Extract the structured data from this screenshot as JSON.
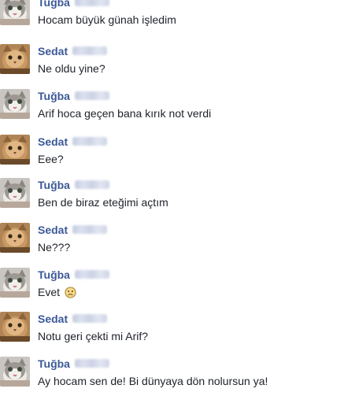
{
  "messages": [
    {
      "sender": "Tuğba",
      "avatar": "kitten-avatar-icon",
      "text": "Hocam büyük günah işledim"
    },
    {
      "sender": "Sedat",
      "avatar": "cat-avatar-icon",
      "text": "Ne oldu yine?"
    },
    {
      "sender": "Tuğba",
      "avatar": "kitten-avatar-icon",
      "text": "Arif hoca geçen bana kırık not verdi"
    },
    {
      "sender": "Sedat",
      "avatar": "cat-avatar-icon",
      "text": "Eee?"
    },
    {
      "sender": "Tuğba",
      "avatar": "kitten-avatar-icon",
      "text": "Ben de biraz eteğimi açtım"
    },
    {
      "sender": "Sedat",
      "avatar": "cat-avatar-icon",
      "text": "Ne???"
    },
    {
      "sender": "Tuğba",
      "avatar": "kitten-avatar-icon",
      "text": "Evet",
      "emoji": "frown-emoji-icon"
    },
    {
      "sender": "Sedat",
      "avatar": "cat-avatar-icon",
      "text": "Notu geri çekti mi Arif?"
    },
    {
      "sender": "Tuğba",
      "avatar": "kitten-avatar-icon",
      "text": "Ay hocam sen de! Bi dünyaya dön nolursun ya!"
    }
  ],
  "colors": {
    "name": "#3b5998",
    "text": "#1d2129",
    "background": "#ffffff"
  }
}
